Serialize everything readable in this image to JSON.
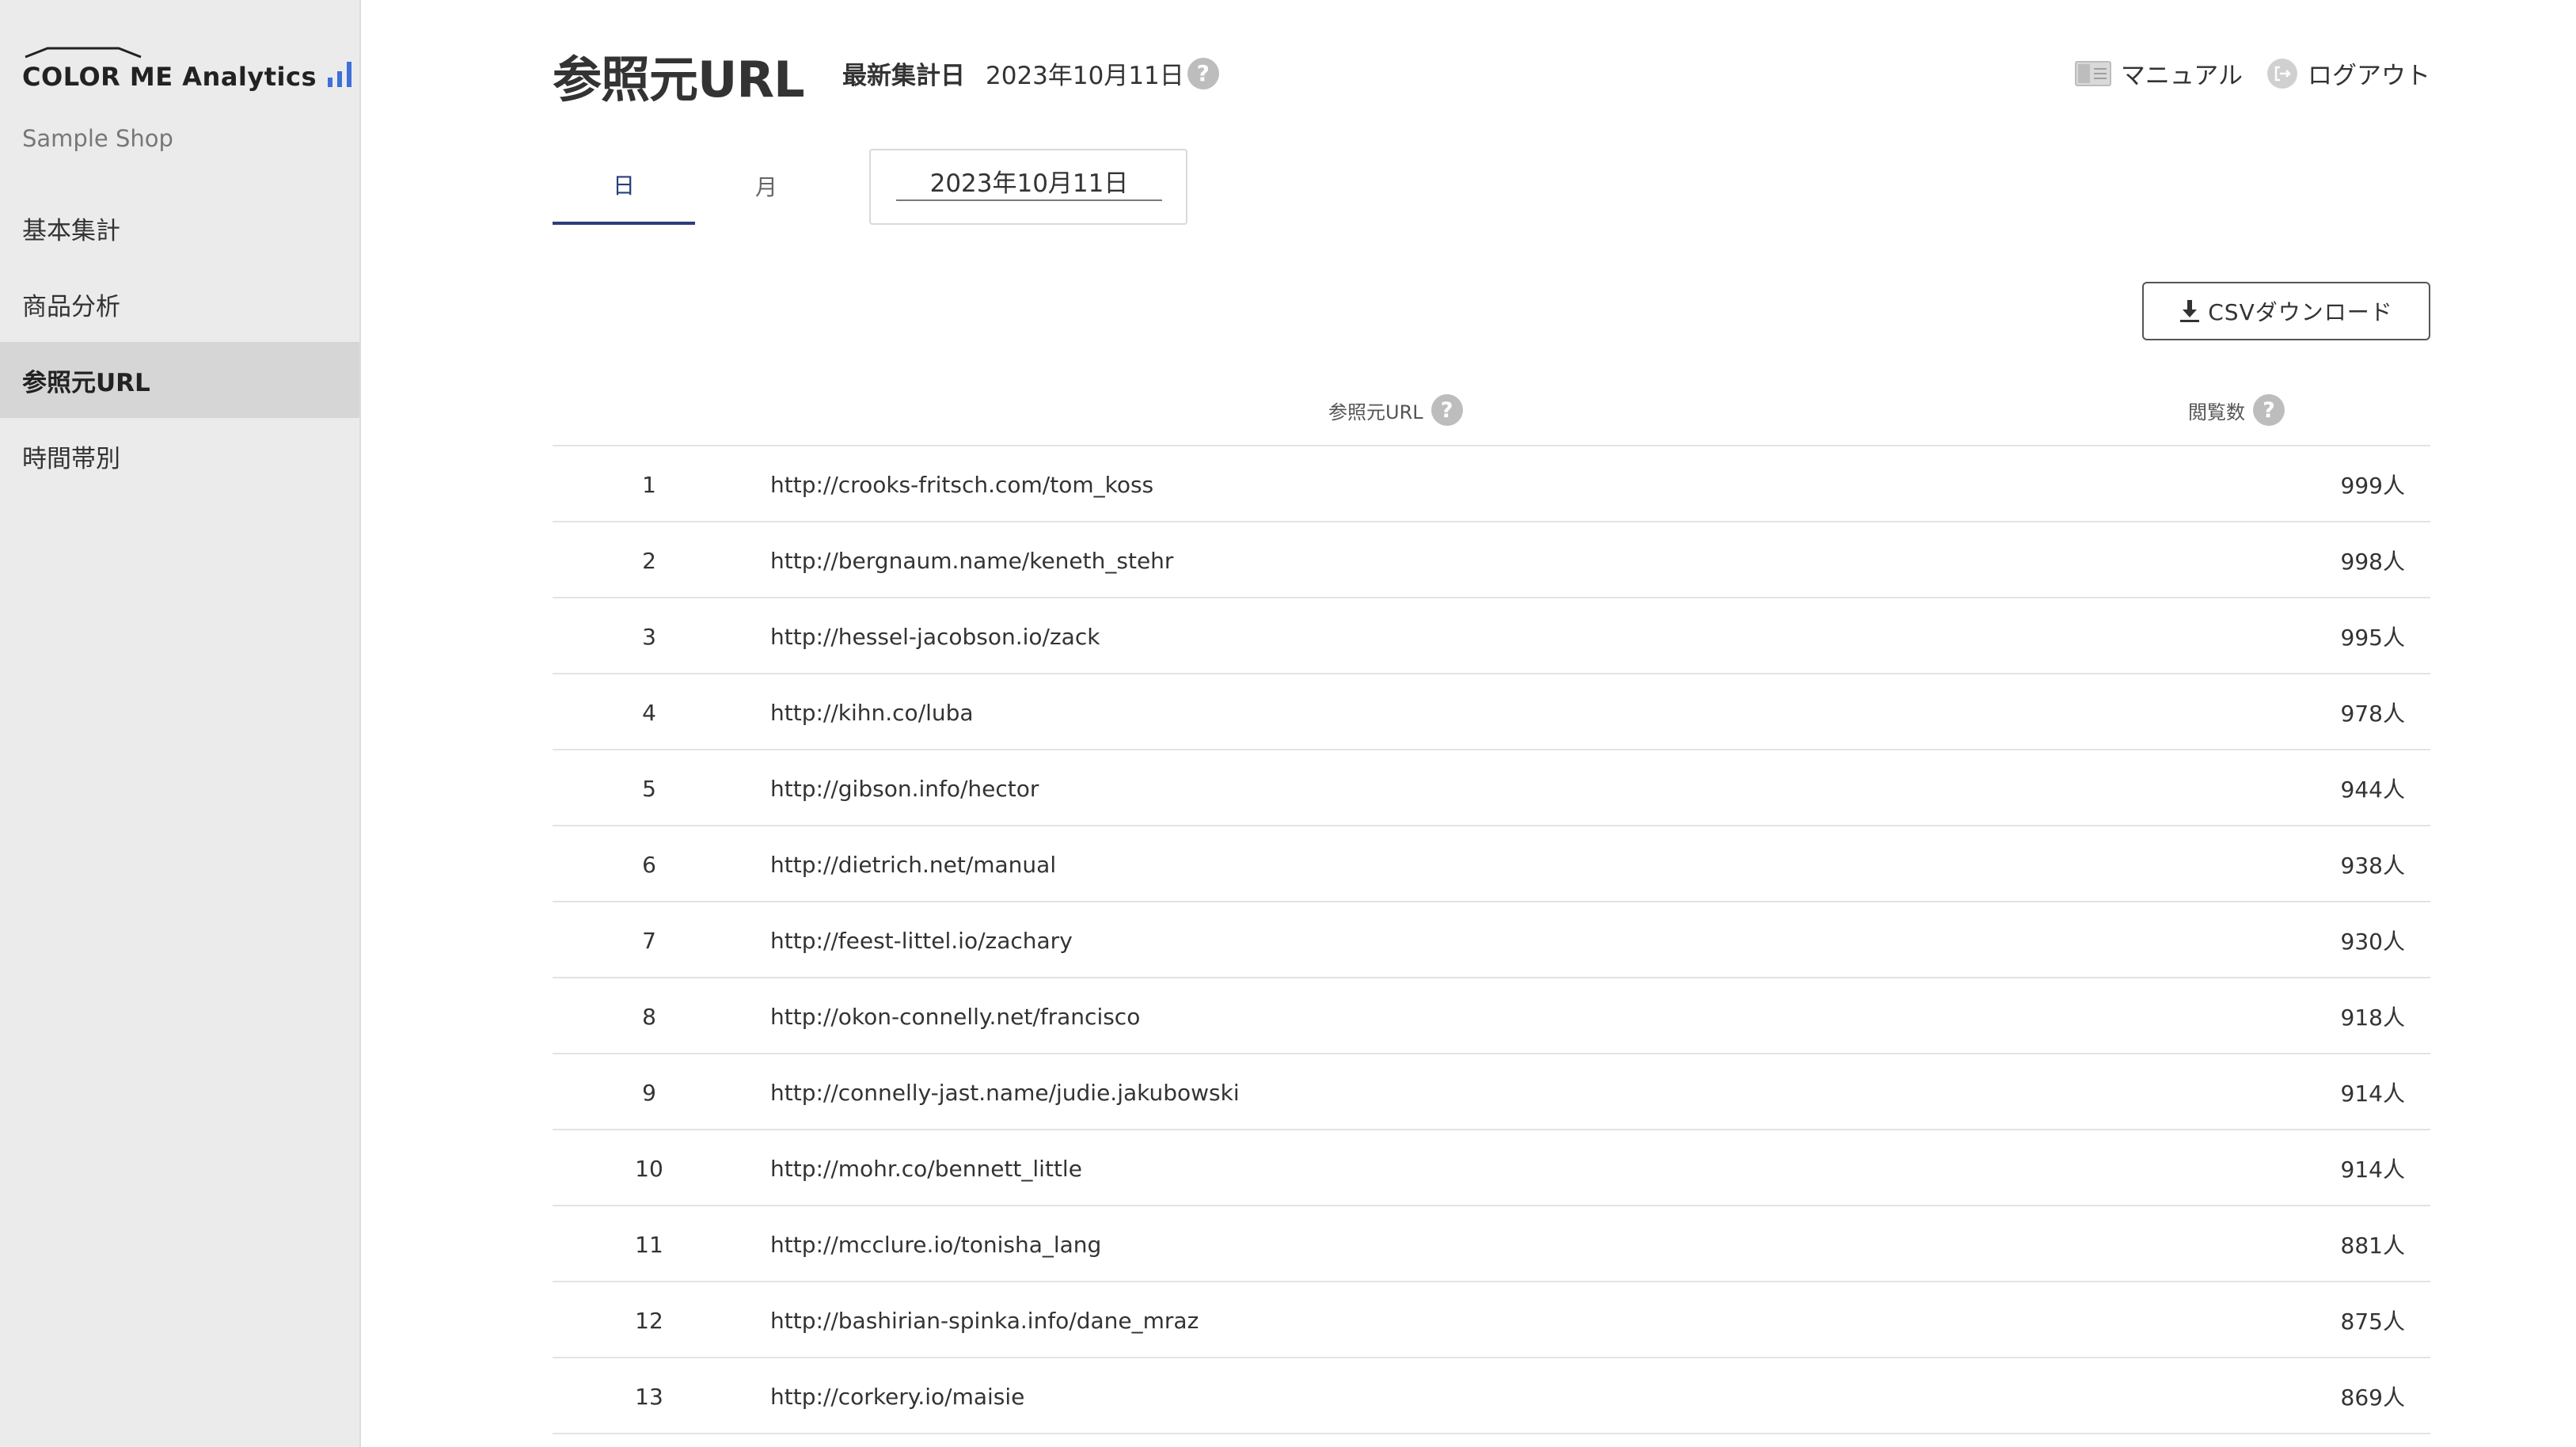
{
  "sidebar": {
    "logo_text": "COLOR ME Analytics",
    "shop_name": "Sample Shop",
    "items": [
      {
        "label": "基本集計"
      },
      {
        "label": "商品分析"
      },
      {
        "label": "参照元URL"
      },
      {
        "label": "時間帯別"
      }
    ],
    "active_index": 2
  },
  "header": {
    "title": "参照元URL",
    "aggregation_label": "最新集計日",
    "aggregation_date": "2023年10月11日",
    "manual_label": "マニュアル",
    "logout_label": "ログアウト"
  },
  "tabs": [
    {
      "label": "日"
    },
    {
      "label": "月"
    }
  ],
  "date_input": {
    "value": "2023年10月11日"
  },
  "csv_button_label": "CSVダウンロード",
  "table": {
    "headers": {
      "url": "参照元URL",
      "views": "閲覧数"
    },
    "rows": [
      {
        "rank": "1",
        "url": "http://crooks-fritsch.com/tom_koss",
        "views": "999人"
      },
      {
        "rank": "2",
        "url": "http://bergnaum.name/keneth_stehr",
        "views": "998人"
      },
      {
        "rank": "3",
        "url": "http://hessel-jacobson.io/zack",
        "views": "995人"
      },
      {
        "rank": "4",
        "url": "http://kihn.co/luba",
        "views": "978人"
      },
      {
        "rank": "5",
        "url": "http://gibson.info/hector",
        "views": "944人"
      },
      {
        "rank": "6",
        "url": "http://dietrich.net/manual",
        "views": "938人"
      },
      {
        "rank": "7",
        "url": "http://feest-littel.io/zachary",
        "views": "930人"
      },
      {
        "rank": "8",
        "url": "http://okon-connelly.net/francisco",
        "views": "918人"
      },
      {
        "rank": "9",
        "url": "http://connelly-jast.name/judie.jakubowski",
        "views": "914人"
      },
      {
        "rank": "10",
        "url": "http://mohr.co/bennett_little",
        "views": "914人"
      },
      {
        "rank": "11",
        "url": "http://mcclure.io/tonisha_lang",
        "views": "881人"
      },
      {
        "rank": "12",
        "url": "http://bashirian-spinka.info/dane_mraz",
        "views": "875人"
      },
      {
        "rank": "13",
        "url": "http://corkery.io/maisie",
        "views": "869人"
      }
    ]
  },
  "colors": {
    "sidebar_bg": "#ebebeb",
    "sidebar_active_bg": "#d6d6d6",
    "tab_active": "#2a3f7a",
    "logo_bars": "#3f6fd8",
    "help_icon": "#bdbdbd"
  },
  "icons": {
    "help": "question-mark-circle",
    "manual": "book-icon",
    "logout": "logout-circle-icon",
    "csv": "download-icon",
    "logo_bars": "bar-chart-icon"
  }
}
